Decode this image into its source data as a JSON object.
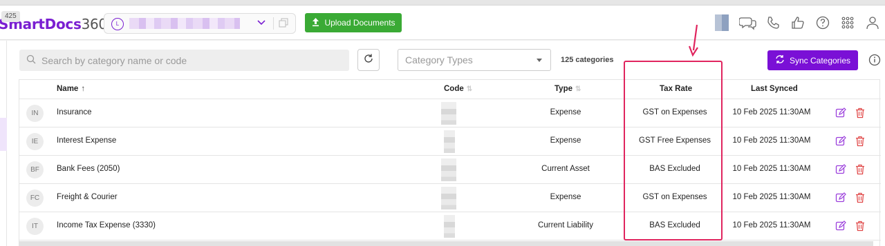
{
  "header": {
    "badge": "425",
    "logo_brand": "SmartDocs",
    "logo_suffix": "360",
    "org_initials": "L",
    "upload_label": "Upload Documents",
    "icons": [
      "user-thumbnail",
      "chat-icon",
      "phone-icon",
      "thumbs-up-icon",
      "help-icon",
      "apps-grid-icon",
      "profile-icon"
    ]
  },
  "toolbar": {
    "search_placeholder": "Search by category name or code",
    "category_types_placeholder": "Category Types",
    "count_label": "125 categories",
    "sync_label": "Sync Categories"
  },
  "table": {
    "columns": {
      "name": "Name",
      "code": "Code",
      "type": "Type",
      "tax_rate": "Tax Rate",
      "last_synced": "Last Synced"
    },
    "rows": [
      {
        "initials": "IN",
        "name": "Insurance",
        "type": "Expense",
        "tax_rate": "GST on Expenses",
        "last_synced": "10 Feb 2025 11:30AM"
      },
      {
        "initials": "IE",
        "name": "Interest Expense",
        "type": "Expense",
        "tax_rate": "GST Free Expenses",
        "last_synced": "10 Feb 2025 11:30AM"
      },
      {
        "initials": "BF",
        "name": "Bank Fees (2050)",
        "type": "Current Asset",
        "tax_rate": "BAS Excluded",
        "last_synced": "10 Feb 2025 11:30AM"
      },
      {
        "initials": "FC",
        "name": "Freight & Courier",
        "type": "Expense",
        "tax_rate": "GST on Expenses",
        "last_synced": "10 Feb 2025 11:30AM"
      },
      {
        "initials": "IT",
        "name": "Income Tax Expense (3330)",
        "type": "Current Liability",
        "tax_rate": "BAS Excluded",
        "last_synced": "10 Feb 2025 11:30AM"
      }
    ]
  },
  "colors": {
    "brand_purple": "#7a10d6",
    "upload_green": "#3aaa35",
    "highlight_pink": "#e0245e",
    "delete_red": "#e04848"
  }
}
